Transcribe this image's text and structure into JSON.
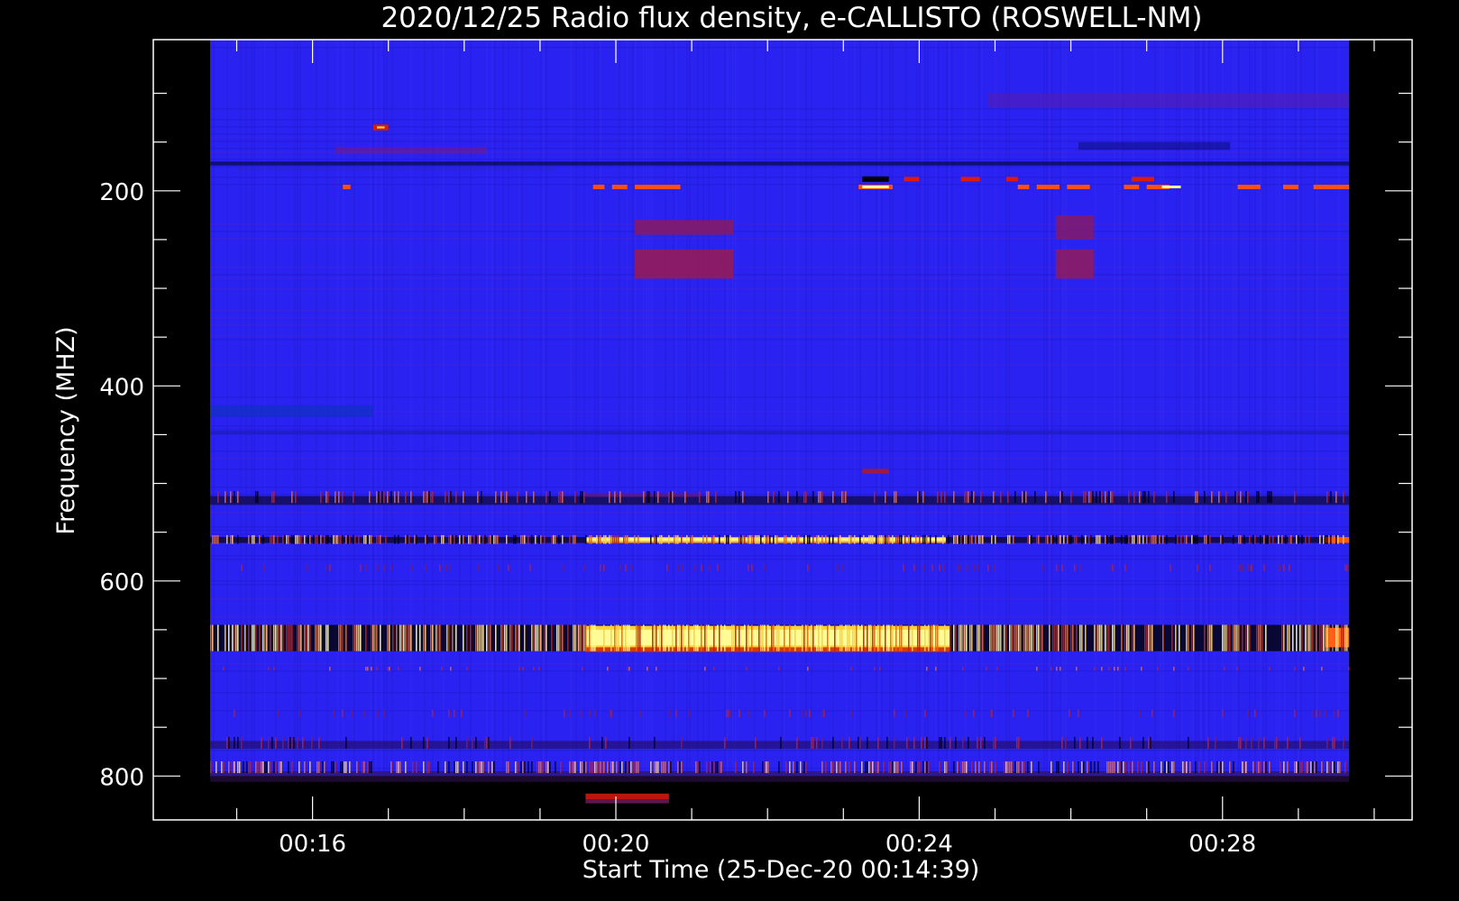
{
  "chart_data": {
    "type": "heatmap",
    "title": "2020/12/25  Radio flux density, e-CALLISTO (ROSWELL-NM)",
    "xlabel": "Start Time (25-Dec-20 00:14:39)",
    "ylabel": "Frequency (MHZ)",
    "x_unit": "minutes after 00:00 UT",
    "xlim": [
      13.9,
      30.5
    ],
    "ylim": [
      845,
      45
    ],
    "data_extent": {
      "t_start": 14.65,
      "t_end": 29.67,
      "f_min": 45,
      "f_max": 800
    },
    "x_major_ticks": [
      {
        "value": 16,
        "label": "00:16"
      },
      {
        "value": 20,
        "label": "00:20"
      },
      {
        "value": 24,
        "label": "00:24"
      },
      {
        "value": 28,
        "label": "00:28"
      }
    ],
    "x_minor_ticks": [
      15,
      17,
      18,
      19,
      21,
      22,
      23,
      25,
      26,
      27,
      29,
      30
    ],
    "y_major_ticks": [
      {
        "value": 200,
        "label": "200"
      },
      {
        "value": 400,
        "label": "400"
      },
      {
        "value": 600,
        "label": "600"
      },
      {
        "value": 800,
        "label": "800"
      }
    ],
    "y_minor_ticks": [
      100,
      150,
      250,
      300,
      350,
      450,
      500,
      550,
      650,
      700,
      750
    ],
    "colorscale": [
      "#000000",
      "#1e10ff",
      "#3a1ce6",
      "#8a1a7a",
      "#cc1a10",
      "#ff5a00",
      "#ffd040",
      "#ffff90"
    ],
    "background_color": "#2a22f0",
    "features": [
      {
        "kind": "band",
        "f1": 155,
        "f2": 162,
        "t1": 16.3,
        "t2": 18.3,
        "color": "#7a1a80",
        "opacity": 0.55
      },
      {
        "kind": "band",
        "f1": 100,
        "f2": 115,
        "t1": 24.9,
        "t2": 29.67,
        "color": "#6a1a90",
        "opacity": 0.4
      },
      {
        "kind": "band",
        "f1": 170,
        "f2": 174,
        "t1": 14.65,
        "t2": 29.67,
        "color": "#0a0a50",
        "opacity": 0.75
      },
      {
        "kind": "band",
        "f1": 150,
        "f2": 158,
        "t1": 26.1,
        "t2": 28.1,
        "color": "#0a0a70",
        "opacity": 0.5
      },
      {
        "kind": "band",
        "f1": 420,
        "f2": 432,
        "t1": 14.65,
        "t2": 16.8,
        "color": "#1030c0",
        "opacity": 0.7
      },
      {
        "kind": "band",
        "f1": 230,
        "f2": 245,
        "t1": 20.25,
        "t2": 21.55,
        "color": "#8a1a60",
        "opacity": 0.85
      },
      {
        "kind": "band",
        "f1": 260,
        "f2": 290,
        "t1": 20.25,
        "t2": 21.55,
        "color": "#9a1a50",
        "opacity": 0.85
      },
      {
        "kind": "band",
        "f1": 225,
        "f2": 250,
        "t1": 25.8,
        "t2": 26.3,
        "color": "#8a1a60",
        "opacity": 0.8
      },
      {
        "kind": "band",
        "f1": 260,
        "f2": 290,
        "t1": 25.8,
        "t2": 26.3,
        "color": "#9a1a50",
        "opacity": 0.8
      },
      {
        "kind": "band",
        "f1": 446,
        "f2": 450,
        "t1": 14.65,
        "t2": 29.67,
        "color": "#1a1ab0",
        "opacity": 0.6
      },
      {
        "kind": "band",
        "f1": 513,
        "f2": 522,
        "t1": 14.65,
        "t2": 29.67,
        "color": "#100830",
        "opacity": 0.7
      },
      {
        "kind": "band",
        "f1": 555,
        "f2": 561,
        "t1": 14.65,
        "t2": 29.67,
        "color": "#100830",
        "opacity": 0.85
      },
      {
        "kind": "band",
        "f1": 555,
        "f2": 561,
        "t1": 19.6,
        "t2": 24.35,
        "color": "#ffb030",
        "opacity": 1
      },
      {
        "kind": "band",
        "f1": 556,
        "f2": 559,
        "t1": 19.6,
        "t2": 24.35,
        "color": "#ffff90",
        "opacity": 0.9
      },
      {
        "kind": "band",
        "f1": 555,
        "f2": 561,
        "t1": 29.35,
        "t2": 29.67,
        "color": "#ff5a00",
        "opacity": 1
      },
      {
        "kind": "band",
        "f1": 645,
        "f2": 672,
        "t1": 14.65,
        "t2": 29.67,
        "color": "#050520",
        "opacity": 0.9
      },
      {
        "kind": "band",
        "f1": 646,
        "f2": 672,
        "t1": 19.6,
        "t2": 24.4,
        "color": "#ffd040",
        "opacity": 1
      },
      {
        "kind": "band",
        "f1": 650,
        "f2": 666,
        "t1": 19.6,
        "t2": 24.4,
        "color": "#ffffa0",
        "opacity": 0.9
      },
      {
        "kind": "band",
        "f1": 668,
        "f2": 673,
        "t1": 19.6,
        "t2": 24.4,
        "color": "#cc3000",
        "opacity": 0.9
      },
      {
        "kind": "band",
        "f1": 648,
        "f2": 668,
        "t1": 29.35,
        "t2": 29.67,
        "color": "#ff6020",
        "opacity": 1
      },
      {
        "kind": "band",
        "f1": 764,
        "f2": 772,
        "t1": 14.65,
        "t2": 29.67,
        "color": "#200838",
        "opacity": 0.5
      },
      {
        "kind": "band",
        "f1": 795,
        "f2": 806,
        "t1": 14.65,
        "t2": 29.67,
        "color": "#301050",
        "opacity": 0.6
      },
      {
        "kind": "band",
        "f1": 818,
        "f2": 824,
        "t1": 19.6,
        "t2": 20.7,
        "color": "#cc1a10",
        "opacity": 0.9
      },
      {
        "kind": "band",
        "f1": 824,
        "f2": 828,
        "t1": 19.6,
        "t2": 20.7,
        "color": "#7a1a60",
        "opacity": 0.8
      },
      {
        "kind": "band",
        "f1": 485,
        "f2": 490,
        "t1": 23.25,
        "t2": 23.6,
        "color": "#aa1a30",
        "opacity": 0.9
      },
      {
        "kind": "band",
        "f1": 510,
        "f2": 514,
        "t1": 19.6,
        "t2": 21.1,
        "color": "#6a1a70",
        "opacity": 0.6
      },
      {
        "kind": "band",
        "f1": 132,
        "f2": 138,
        "t1": 16.8,
        "t2": 17.0,
        "color": "#cc2010",
        "opacity": 1
      },
      {
        "kind": "band",
        "f1": 134,
        "f2": 136,
        "t1": 16.85,
        "t2": 16.95,
        "color": "#ffd040",
        "opacity": 1
      },
      {
        "kind": "band",
        "f1": 177,
        "f2": 179,
        "t1": 15.0,
        "t2": 19.2,
        "color": "#2a2aa0",
        "opacity": 0.5
      }
    ],
    "bursts": [
      {
        "f": 196,
        "h": 5,
        "segments": [
          [
            16.4,
            16.5
          ],
          [
            19.7,
            19.85
          ],
          [
            19.95,
            20.15
          ],
          [
            20.25,
            20.85
          ]
        ],
        "color": "#ff5010"
      },
      {
        "f": 196,
        "h": 5,
        "segments": [
          [
            23.2,
            23.65
          ],
          [
            25.3,
            25.45
          ],
          [
            25.55,
            25.85
          ],
          [
            25.95,
            26.25
          ],
          [
            26.7,
            26.9
          ],
          [
            27.0,
            27.3
          ],
          [
            28.2,
            28.5
          ],
          [
            28.8,
            29.0
          ],
          [
            29.2,
            29.67
          ]
        ],
        "color": "#ff5010"
      },
      {
        "f": 196,
        "h": 3,
        "segments": [
          [
            23.25,
            23.6
          ],
          [
            27.2,
            27.45
          ]
        ],
        "color": "#ffff90"
      },
      {
        "f": 188,
        "h": 6,
        "segments": [
          [
            23.25,
            23.6
          ]
        ],
        "color": "#000000"
      },
      {
        "f": 188,
        "h": 5,
        "segments": [
          [
            23.8,
            24.0
          ],
          [
            24.55,
            24.8
          ],
          [
            25.15,
            25.3
          ],
          [
            26.8,
            27.1
          ]
        ],
        "color": "#dd1a10"
      }
    ],
    "streak_bands": [
      {
        "f1": 508,
        "f2": 520,
        "density": 0.25,
        "colors": [
          "#cc1a10",
          "#ff6000",
          "#000000"
        ]
      },
      {
        "f1": 553,
        "f2": 562,
        "density": 0.55,
        "colors": [
          "#cc1a10",
          "#ff6000",
          "#ffd040",
          "#000000"
        ]
      },
      {
        "f1": 583,
        "f2": 590,
        "density": 0.12,
        "colors": [
          "#cc1a10",
          "#8a1a40"
        ]
      },
      {
        "f1": 645,
        "f2": 672,
        "density": 0.6,
        "colors": [
          "#cc1a10",
          "#ff6000",
          "#ffd040",
          "#ffff90"
        ]
      },
      {
        "f1": 688,
        "f2": 692,
        "density": 0.08,
        "colors": [
          "#cc1a10",
          "#ff6000"
        ]
      },
      {
        "f1": 732,
        "f2": 740,
        "density": 0.08,
        "colors": [
          "#cc1a10",
          "#8a1a40"
        ]
      },
      {
        "f1": 760,
        "f2": 772,
        "density": 0.15,
        "colors": [
          "#000000",
          "#8a1a40",
          "#cc1a10"
        ]
      },
      {
        "f1": 785,
        "f2": 797,
        "density": 0.45,
        "colors": [
          "#cc1a10",
          "#ff6000",
          "#ffd040",
          "#000000"
        ]
      }
    ]
  }
}
